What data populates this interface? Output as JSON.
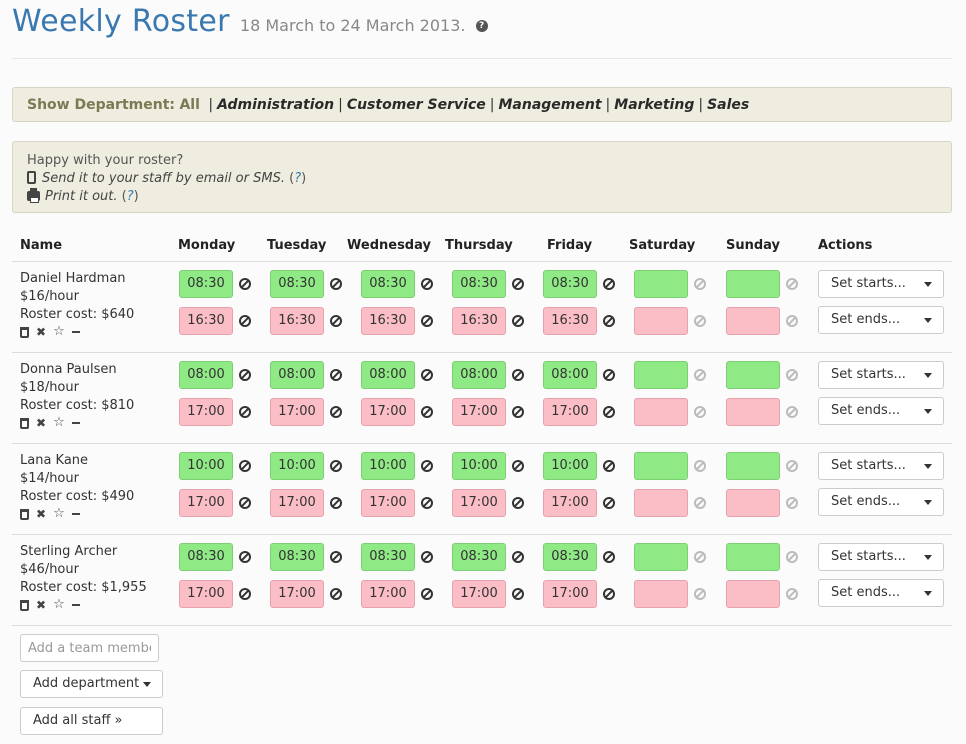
{
  "header": {
    "title": "Weekly Roster",
    "date_range": "18 March to 24 March 2013."
  },
  "departments": {
    "label": "Show Department:",
    "current": "All",
    "items": [
      "Administration",
      "Customer Service",
      "Management",
      "Marketing",
      "Sales"
    ]
  },
  "info": {
    "prompt": "Happy with your roster?",
    "send_text": "Send it to your staff by email or SMS.",
    "print_text": "Print it out.",
    "help_link": "?"
  },
  "columns": [
    "Name",
    "Monday",
    "Tuesday",
    "Wednesday",
    "Thursday",
    "Friday",
    "Saturday",
    "Sunday",
    "Actions"
  ],
  "staff": [
    {
      "name": "Daniel Hardman",
      "rate": "$16/hour",
      "cost": "Roster cost: $640",
      "starts": [
        "08:30",
        "08:30",
        "08:30",
        "08:30",
        "08:30",
        "",
        ""
      ],
      "ends": [
        "16:30",
        "16:30",
        "16:30",
        "16:30",
        "16:30",
        "",
        ""
      ]
    },
    {
      "name": "Donna Paulsen",
      "rate": "$18/hour",
      "cost": "Roster cost: $810",
      "starts": [
        "08:00",
        "08:00",
        "08:00",
        "08:00",
        "08:00",
        "",
        ""
      ],
      "ends": [
        "17:00",
        "17:00",
        "17:00",
        "17:00",
        "17:00",
        "",
        ""
      ]
    },
    {
      "name": "Lana Kane",
      "rate": "$14/hour",
      "cost": "Roster cost: $490",
      "starts": [
        "10:00",
        "10:00",
        "10:00",
        "10:00",
        "10:00",
        "",
        ""
      ],
      "ends": [
        "17:00",
        "17:00",
        "17:00",
        "17:00",
        "17:00",
        "",
        ""
      ]
    },
    {
      "name": "Sterling Archer",
      "rate": "$46/hour",
      "cost": "Roster cost: $1,955",
      "starts": [
        "08:30",
        "08:30",
        "08:30",
        "08:30",
        "08:30",
        "",
        ""
      ],
      "ends": [
        "17:00",
        "17:00",
        "17:00",
        "17:00",
        "17:00",
        "",
        ""
      ]
    }
  ],
  "actions": {
    "set_starts": "Set starts...",
    "set_ends": "Set ends..."
  },
  "footer": {
    "add_member_placeholder": "Add a team member",
    "add_department": "Add department",
    "add_all_staff": "Add all staff »"
  },
  "colors": {
    "start": "#8fea85",
    "end": "#fbbdc6",
    "title": "#3a78b0"
  }
}
